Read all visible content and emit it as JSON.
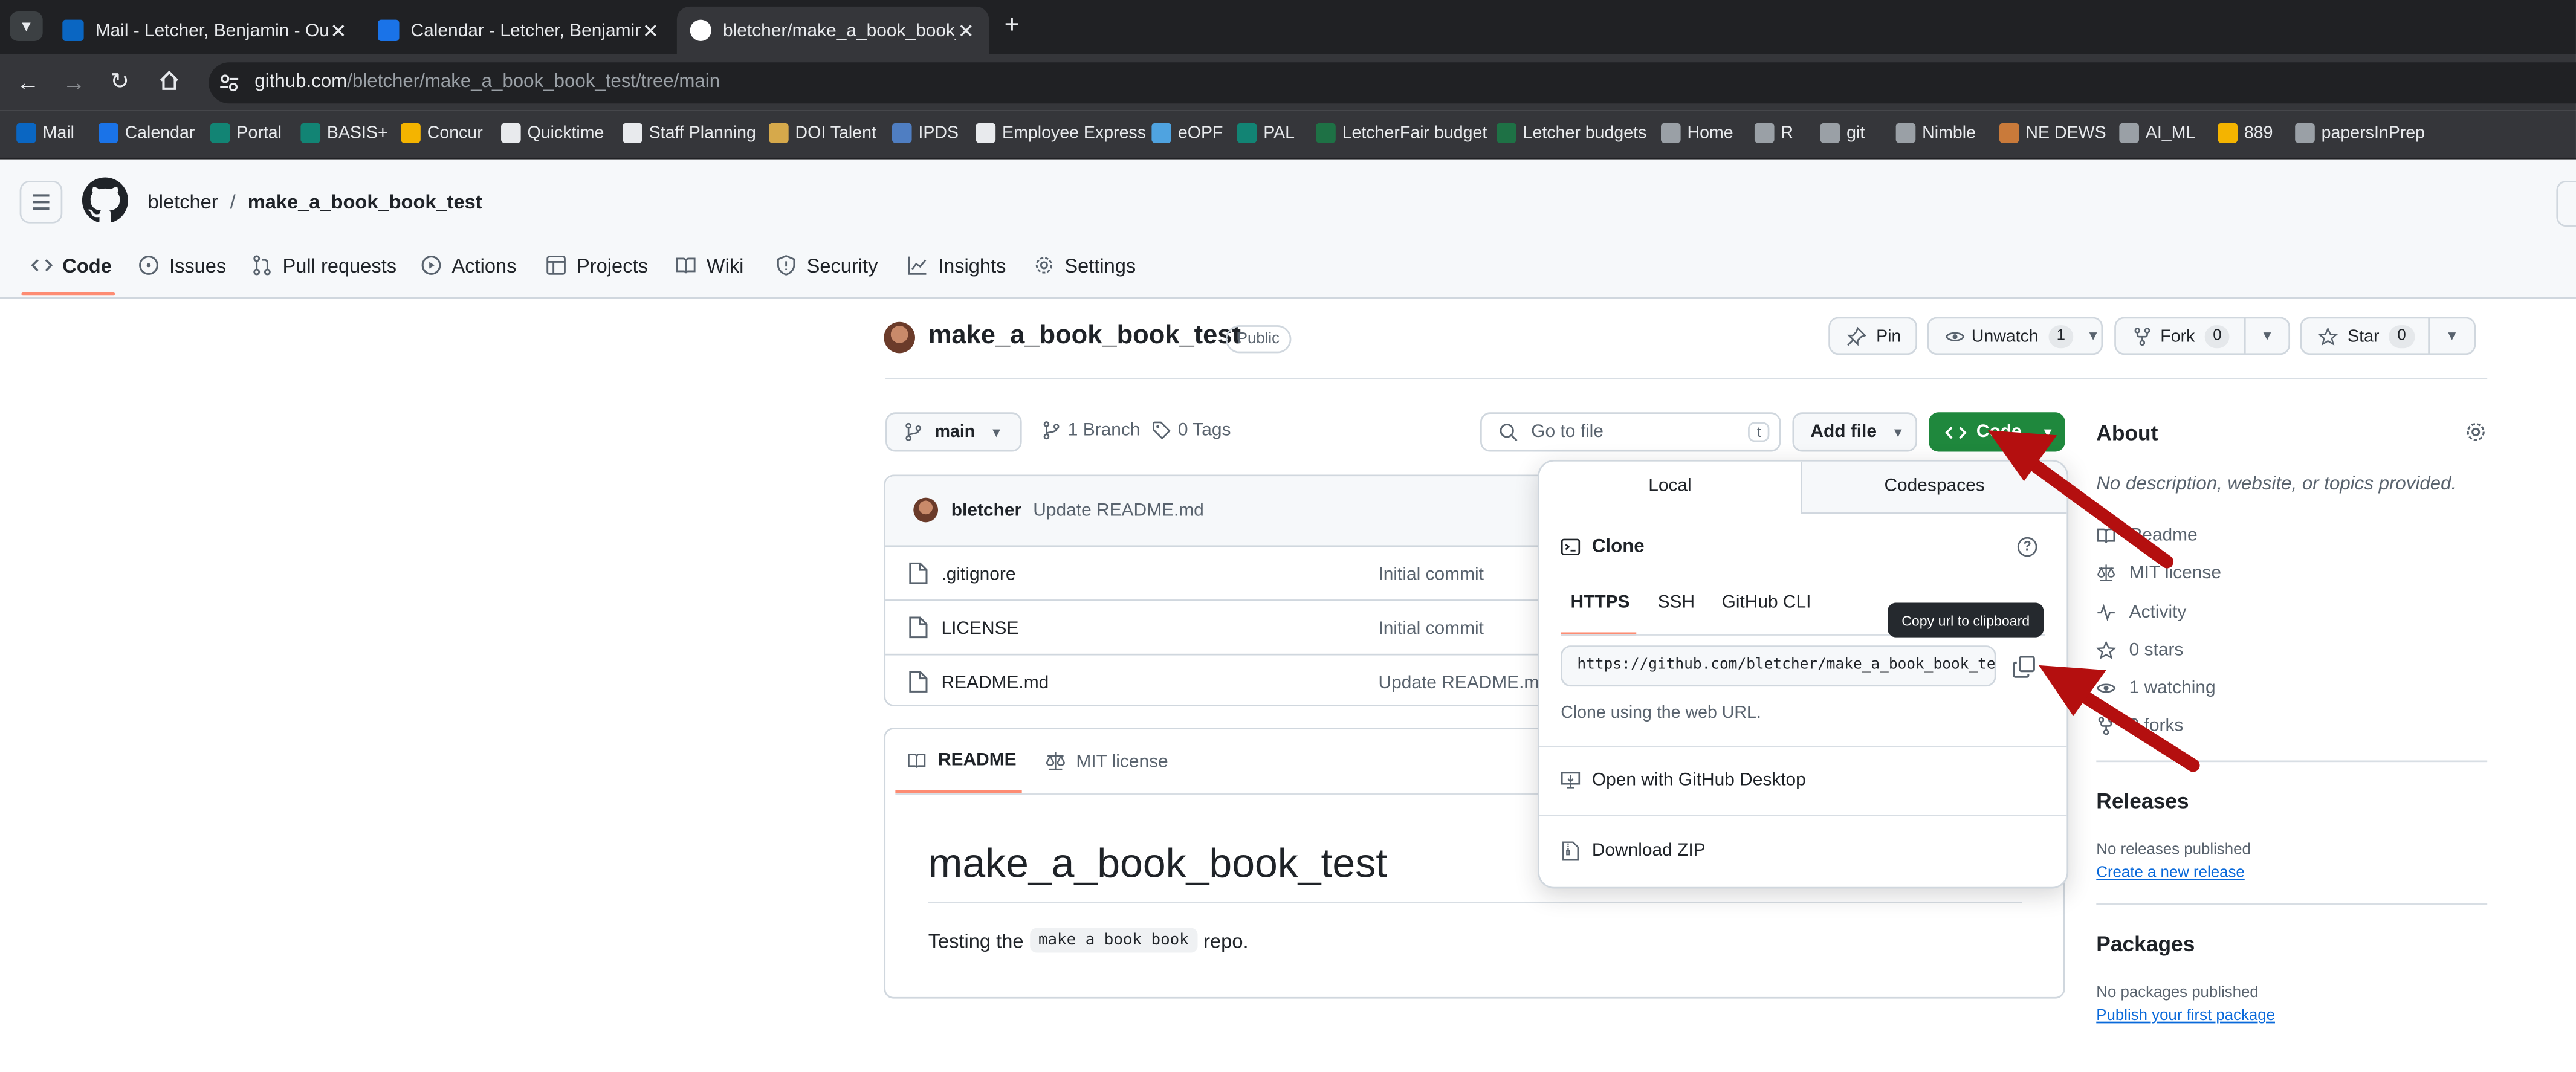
{
  "browser": {
    "tabs": [
      {
        "title": "Mail - Letcher, Benjamin - Outlook",
        "color": "#0a66c2"
      },
      {
        "title": "Calendar - Letcher, Benjamin - Outlook",
        "color": "#1a73e8"
      },
      {
        "title": "bletcher/make_a_book_book_test",
        "color": "#ffffff"
      }
    ],
    "url_host": "github.com",
    "url_path": "/bletcher/make_a_book_book_test/tree/main",
    "bookmarks": [
      {
        "label": "Mail",
        "color": "#0a66c2"
      },
      {
        "label": "Calendar",
        "color": "#1a73e8"
      },
      {
        "label": "Portal",
        "color": "#128474"
      },
      {
        "label": "BASIS+",
        "color": "#128474"
      },
      {
        "label": "Concur",
        "color": "#f4b400"
      },
      {
        "label": "Quicktime",
        "color": "#e8eaed"
      },
      {
        "label": "Staff Planning",
        "color": "#e8eaed"
      },
      {
        "label": "DOI Talent",
        "color": "#d6a94b"
      },
      {
        "label": "IPDS",
        "color": "#4f7ec2"
      },
      {
        "label": "Employee Express",
        "color": "#e8eaed"
      },
      {
        "label": "eOPF",
        "color": "#4fa3e0"
      },
      {
        "label": "PAL",
        "color": "#128474"
      },
      {
        "label": "LetcherFair budget",
        "color": "#1e7145"
      },
      {
        "label": "Letcher budgets",
        "color": "#1e7145"
      },
      {
        "label": "Home",
        "color": "#9aa0a6"
      },
      {
        "label": "R",
        "color": "#9aa0a6"
      },
      {
        "label": "git",
        "color": "#9aa0a6"
      },
      {
        "label": "Nimble",
        "color": "#9aa0a6"
      },
      {
        "label": "NE DEWS",
        "color": "#c97a3a"
      },
      {
        "label": "AI_ML",
        "color": "#9aa0a6"
      },
      {
        "label": "889",
        "color": "#f4b400"
      },
      {
        "label": "papersInPrep",
        "color": "#9aa0a6"
      }
    ]
  },
  "github": {
    "owner": "bletcher",
    "separator": "/",
    "repo": "make_a_book_book_test",
    "nav": [
      "Code",
      "Issues",
      "Pull requests",
      "Actions",
      "Projects",
      "Wiki",
      "Security",
      "Insights",
      "Settings"
    ],
    "visibility": "Public",
    "pin": "Pin",
    "unwatch": "Unwatch",
    "unwatch_count": "1",
    "fork": "Fork",
    "fork_count": "0",
    "star": "Star",
    "star_count": "0",
    "branch": "main",
    "branches": "1 Branch",
    "tags": "0 Tags",
    "goto_placeholder": "Go to file",
    "goto_key": "t",
    "add_file": "Add file",
    "code_button": "Code",
    "commit_author": "bletcher",
    "commit_message": "Update README.md",
    "files": [
      {
        "name": ".gitignore",
        "commit": "Initial commit"
      },
      {
        "name": "LICENSE",
        "commit": "Initial commit"
      },
      {
        "name": "README.md",
        "commit": "Update README.md"
      }
    ],
    "readme_tabs": [
      "README",
      "MIT license"
    ],
    "readme_title": "make_a_book_book_test",
    "readme_text_before": "Testing the",
    "readme_code": "make_a_book_book",
    "readme_text_after": "repo."
  },
  "code_popup": {
    "tabs": [
      "Local",
      "Codespaces"
    ],
    "clone_title": "Clone",
    "protocols": [
      "HTTPS",
      "SSH",
      "GitHub CLI"
    ],
    "clone_url": "https://github.com/bletcher/make_a_book_book_test.git",
    "hint": "Clone using the web URL.",
    "desktop": "Open with GitHub Desktop",
    "zip": "Download ZIP",
    "tooltip": "Copy url to clipboard"
  },
  "about": {
    "title": "About",
    "description": "No description, website, or topics provided.",
    "items": [
      "Readme",
      "MIT license",
      "Activity",
      "0 stars",
      "1 watching",
      "0 forks"
    ],
    "releases_title": "Releases",
    "releases_none": "No releases published",
    "releases_link": "Create a new release",
    "packages_title": "Packages",
    "packages_none": "No packages published",
    "packages_link": "Publish your first package"
  },
  "colors": {
    "green": "#1f883d",
    "arrow": "#b40f0f",
    "link": "#0969da",
    "accent_underline": "#fd8c73"
  }
}
